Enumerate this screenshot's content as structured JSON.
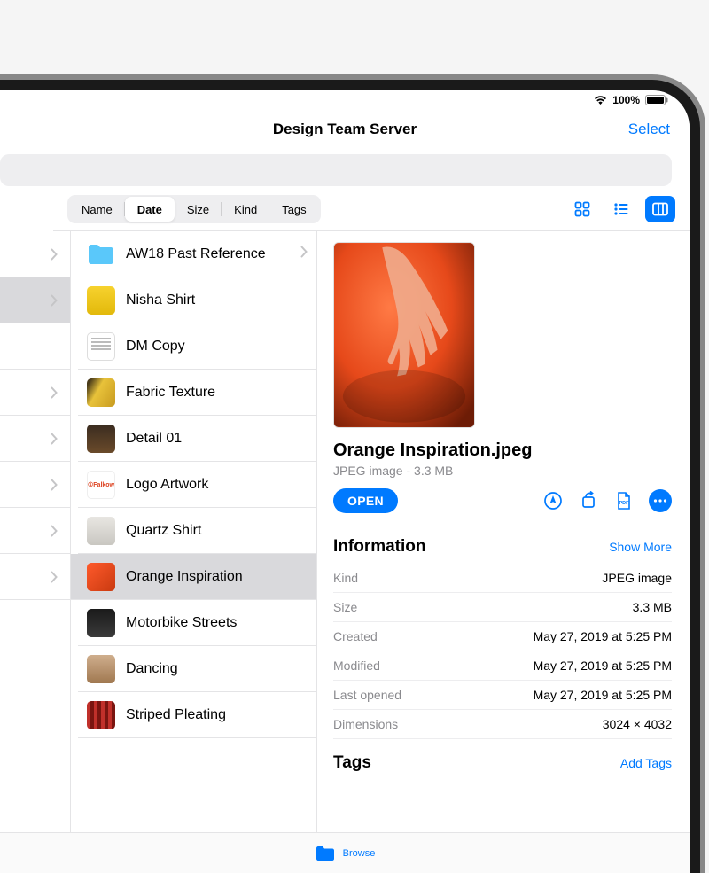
{
  "status": {
    "battery": "100%"
  },
  "header": {
    "title": "Design Team Server",
    "select": "Select"
  },
  "sort": {
    "options": [
      "Name",
      "Date",
      "Size",
      "Kind",
      "Tags"
    ],
    "selected": "Date"
  },
  "leftColumn": {
    "rows": 8,
    "selectedIndex": 1
  },
  "files": [
    {
      "name": "AW18 Past Reference",
      "type": "folder",
      "hasChevron": true
    },
    {
      "name": "Nisha Shirt",
      "thumbClass": "t-yellow"
    },
    {
      "name": "DM Copy",
      "thumbClass": "t-doc"
    },
    {
      "name": "Fabric Texture",
      "thumbClass": "t-banana"
    },
    {
      "name": "Detail 01",
      "thumbClass": "t-detail"
    },
    {
      "name": "Logo Artwork",
      "thumbClass": "t-logo",
      "thumbText": "①Falkow"
    },
    {
      "name": "Quartz Shirt",
      "thumbClass": "t-quartz"
    },
    {
      "name": "Orange Inspiration",
      "thumbClass": "t-orange",
      "selected": true
    },
    {
      "name": "Motorbike Streets",
      "thumbClass": "t-moto"
    },
    {
      "name": "Dancing",
      "thumbClass": "t-dance"
    },
    {
      "name": "Striped Pleating",
      "thumbClass": "t-stripe"
    }
  ],
  "detail": {
    "filename": "Orange Inspiration.jpeg",
    "subtitle": "JPEG image - 3.3 MB",
    "openLabel": "OPEN",
    "infoTitle": "Information",
    "showMore": "Show More",
    "info": [
      {
        "key": "Kind",
        "val": "JPEG image"
      },
      {
        "key": "Size",
        "val": "3.3 MB"
      },
      {
        "key": "Created",
        "val": "May 27, 2019 at 5:25 PM"
      },
      {
        "key": "Modified",
        "val": "May 27, 2019 at 5:25 PM"
      },
      {
        "key": "Last opened",
        "val": "May 27, 2019 at 5:25 PM"
      },
      {
        "key": "Dimensions",
        "val": "3024 × 4032"
      }
    ],
    "tagsTitle": "Tags",
    "addTags": "Add Tags"
  },
  "bottom": {
    "browse": "Browse"
  }
}
